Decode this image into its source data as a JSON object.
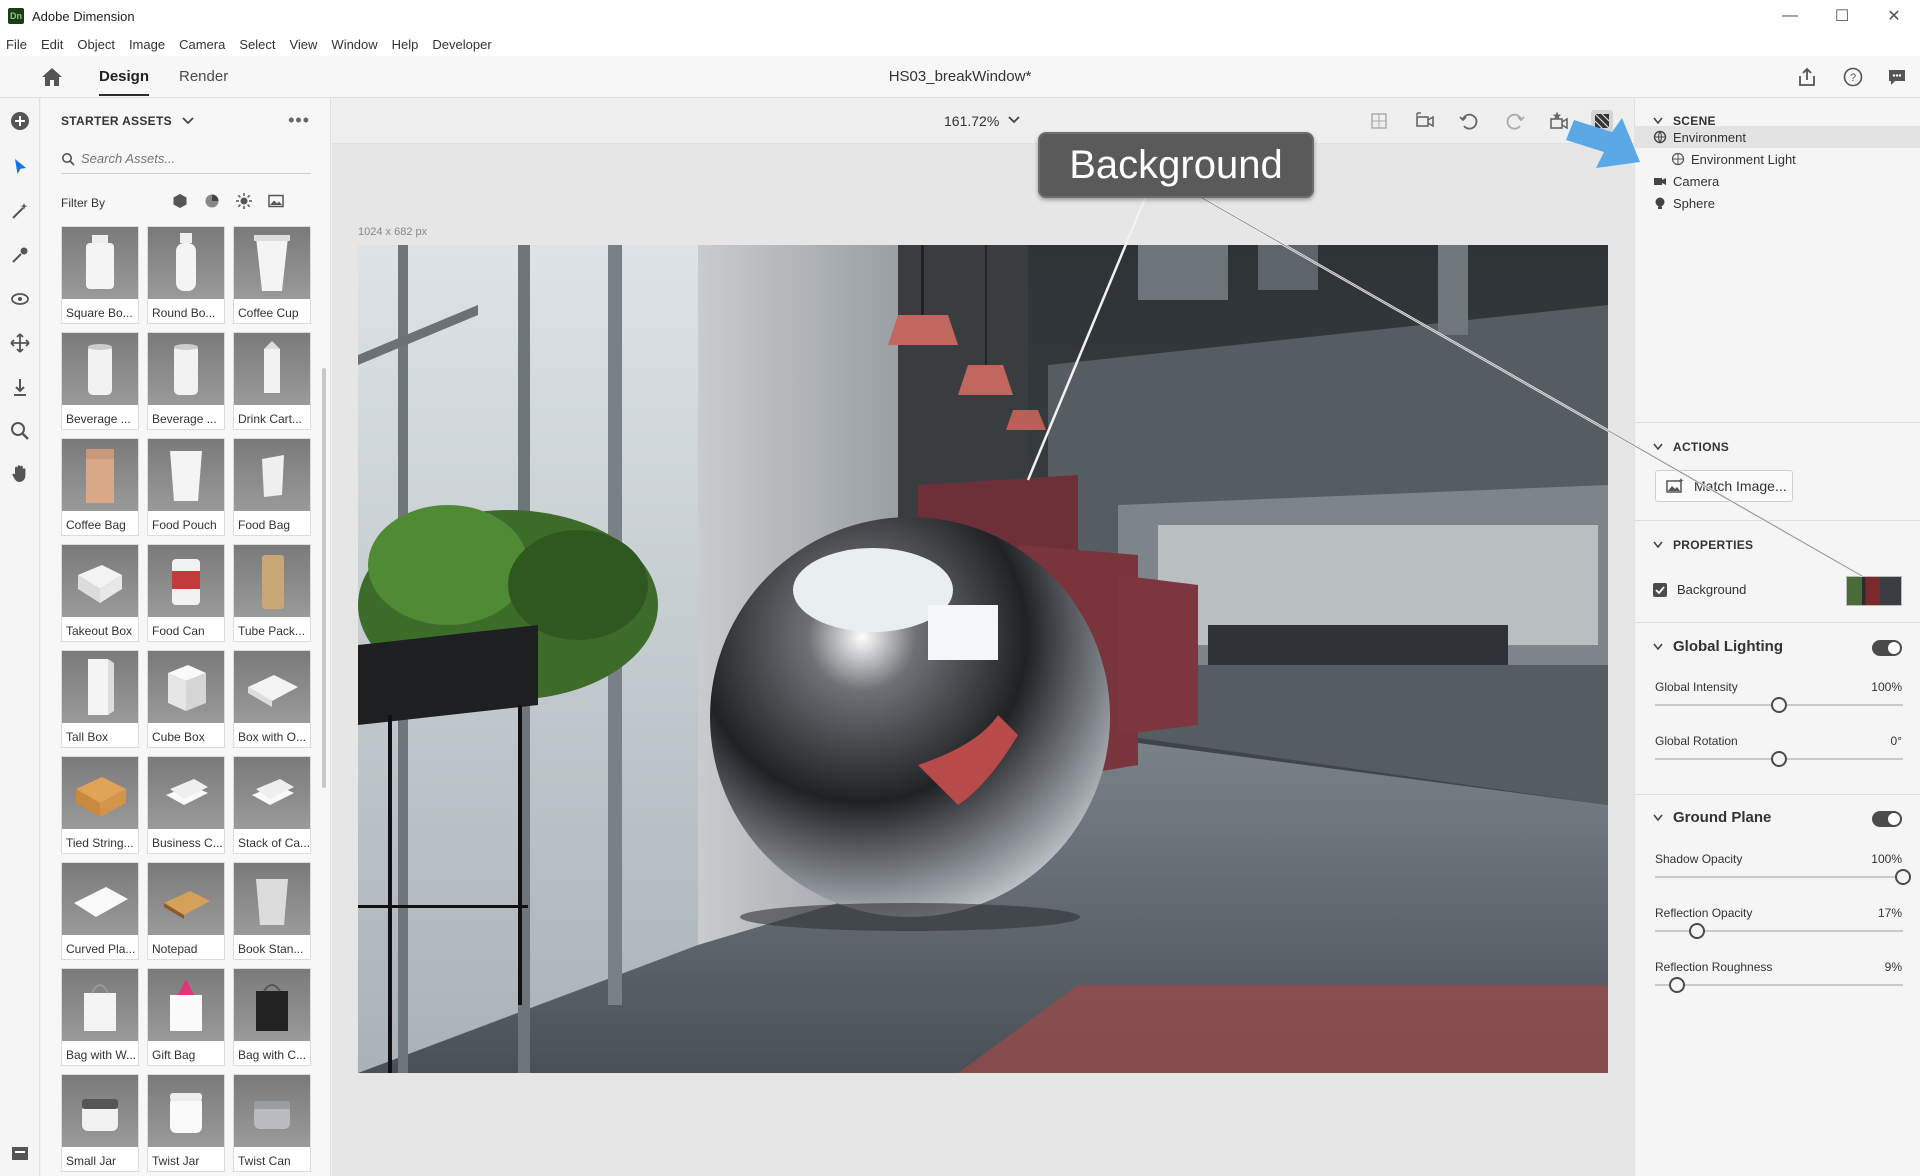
{
  "app": {
    "logo_text": "Dn",
    "title": "Adobe Dimension",
    "window_controls": [
      "—",
      "☐",
      "✕"
    ]
  },
  "menu": [
    "File",
    "Edit",
    "Object",
    "Image",
    "Camera",
    "Select",
    "View",
    "Window",
    "Help",
    "Developer"
  ],
  "header": {
    "tabs": [
      {
        "label": "Design",
        "active": true
      },
      {
        "label": "Render",
        "active": false
      }
    ],
    "document_title": "HS03_breakWindow*"
  },
  "assets": {
    "heading": "STARTER ASSETS",
    "search_placeholder": "Search Assets...",
    "filter_label": "Filter By",
    "items": [
      {
        "label": "Square Bo...",
        "shape": "bottle-square"
      },
      {
        "label": "Round Bo...",
        "shape": "bottle-round"
      },
      {
        "label": "Coffee Cup",
        "shape": "cup"
      },
      {
        "label": "Beverage ...",
        "shape": "can"
      },
      {
        "label": "Beverage ...",
        "shape": "can"
      },
      {
        "label": "Drink Cart...",
        "shape": "carton"
      },
      {
        "label": "Coffee Bag",
        "shape": "bag-coffee"
      },
      {
        "label": "Food Pouch",
        "shape": "pouch"
      },
      {
        "label": "Food Bag",
        "shape": "pouch-small"
      },
      {
        "label": "Takeout Box",
        "shape": "takeout"
      },
      {
        "label": "Food Can",
        "shape": "food-can"
      },
      {
        "label": "Tube Pack...",
        "shape": "tube"
      },
      {
        "label": "Tall Box",
        "shape": "tall-box"
      },
      {
        "label": "Cube Box",
        "shape": "cube"
      },
      {
        "label": "Box with O...",
        "shape": "flat-box"
      },
      {
        "label": "Tied String...",
        "shape": "parcel"
      },
      {
        "label": "Business C...",
        "shape": "cards"
      },
      {
        "label": "Stack of Ca...",
        "shape": "cards"
      },
      {
        "label": "Curved Pla...",
        "shape": "plane"
      },
      {
        "label": "Notepad",
        "shape": "notepad"
      },
      {
        "label": "Book Stan...",
        "shape": "book"
      },
      {
        "label": "Bag with W...",
        "shape": "shopping-bag"
      },
      {
        "label": "Gift Bag",
        "shape": "gift-bag"
      },
      {
        "label": "Bag with C...",
        "shape": "dark-bag"
      },
      {
        "label": "Small Jar",
        "shape": "jar"
      },
      {
        "label": "Twist Jar",
        "shape": "jar-tall"
      },
      {
        "label": "Twist Can",
        "shape": "twist-can"
      }
    ]
  },
  "canvas": {
    "zoom": "161.72%",
    "dimensions": "1024 x 682 px",
    "callout": "Background"
  },
  "scene": {
    "heading": "SCENE",
    "items": [
      {
        "label": "Environment",
        "icon": "environment-icon",
        "selected": true,
        "indent": 0
      },
      {
        "label": "Environment Light",
        "icon": "globe-icon",
        "selected": false,
        "indent": 1
      },
      {
        "label": "Camera",
        "icon": "camera-icon",
        "selected": false,
        "indent": 0
      },
      {
        "label": "Sphere",
        "icon": "sphere-icon",
        "selected": false,
        "indent": 0
      }
    ]
  },
  "actions": {
    "heading": "ACTIONS",
    "match_image_label": "Match Image..."
  },
  "properties": {
    "heading": "PROPERTIES",
    "background_label": "Background",
    "background_checked": true,
    "global_lighting": {
      "title": "Global Lighting",
      "enabled": true,
      "sliders": [
        {
          "label": "Global Intensity",
          "value": "100%",
          "position": 0.5
        },
        {
          "label": "Global Rotation",
          "value": "0°",
          "position": 0.5
        }
      ]
    },
    "ground_plane": {
      "title": "Ground Plane",
      "enabled": true,
      "sliders": [
        {
          "label": "Shadow Opacity",
          "value": "100%",
          "position": 1.0
        },
        {
          "label": "Reflection Opacity",
          "value": "17%",
          "position": 0.17
        },
        {
          "label": "Reflection Roughness",
          "value": "9%",
          "position": 0.09
        }
      ]
    }
  },
  "colors": {
    "accent": "#4b4b4b",
    "callout_bg": "#5a5a5a",
    "annotation_arrow": "#5aa9e6",
    "selection_tool": "#1473e6"
  }
}
